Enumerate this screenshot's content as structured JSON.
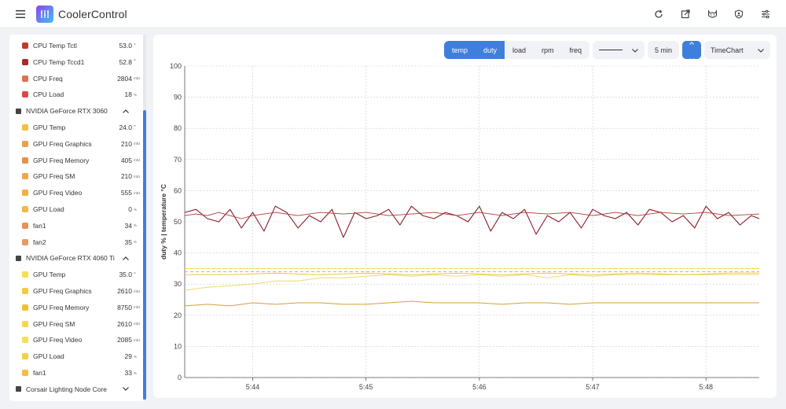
{
  "app": {
    "title": "CoolerControl"
  },
  "icons": {
    "menu": "hamburger-icon",
    "logo": "coolercontrol-logo-icon",
    "top": [
      "refresh-icon",
      "open-external-icon",
      "cat-icon",
      "shield-user-icon",
      "settings-sliders-icon"
    ]
  },
  "sidebar": {
    "rows": [
      {
        "kind": "sensor",
        "name": "CPU Temp Tctl",
        "value": "53.0",
        "unit": "°",
        "color": "#c0392b"
      },
      {
        "kind": "sensor",
        "name": "CPU Temp Tccd1",
        "value": "52.8",
        "unit": "°",
        "color": "#a52a2a"
      },
      {
        "kind": "sensor",
        "name": "CPU Freq",
        "value": "2804",
        "unit": "mhz",
        "color": "#e07050"
      },
      {
        "kind": "sensor",
        "name": "CPU Load",
        "value": "18",
        "unit": "%",
        "color": "#d94848"
      },
      {
        "kind": "group",
        "name": "NVIDIA GeForce RTX 3060"
      },
      {
        "kind": "sensor",
        "name": "GPU Temp",
        "value": "24.0",
        "unit": "°",
        "color": "#f0c040"
      },
      {
        "kind": "sensor",
        "name": "GPU Freq Graphics",
        "value": "210",
        "unit": "mhz",
        "color": "#e8a050"
      },
      {
        "kind": "sensor",
        "name": "GPU Freq Memory",
        "value": "405",
        "unit": "mhz",
        "color": "#e89048"
      },
      {
        "kind": "sensor",
        "name": "GPU Freq SM",
        "value": "210",
        "unit": "mhz",
        "color": "#f0a848"
      },
      {
        "kind": "sensor",
        "name": "GPU Freq Video",
        "value": "555",
        "unit": "mhz",
        "color": "#f0b040"
      },
      {
        "kind": "sensor",
        "name": "GPU Load",
        "value": "0",
        "unit": "%",
        "color": "#f2b848"
      },
      {
        "kind": "sensor",
        "name": "fan1",
        "value": "34",
        "unit": "%",
        "color": "#e8905a"
      },
      {
        "kind": "sensor",
        "name": "fan2",
        "value": "35",
        "unit": "%",
        "color": "#e89860"
      },
      {
        "kind": "group",
        "name": "NVIDIA GeForce RTX 4060 Ti"
      },
      {
        "kind": "sensor",
        "name": "GPU Temp",
        "value": "35.0",
        "unit": "°",
        "color": "#f5e050"
      },
      {
        "kind": "sensor",
        "name": "GPU Freq Graphics",
        "value": "2610",
        "unit": "mhz",
        "color": "#f2cc3c"
      },
      {
        "kind": "sensor",
        "name": "GPU Freq Memory",
        "value": "8750",
        "unit": "mhz",
        "color": "#f0c030"
      },
      {
        "kind": "sensor",
        "name": "GPU Freq SM",
        "value": "2610",
        "unit": "mhz",
        "color": "#f5d848"
      },
      {
        "kind": "sensor",
        "name": "GPU Freq Video",
        "value": "2085",
        "unit": "mhz",
        "color": "#f5e058"
      },
      {
        "kind": "sensor",
        "name": "GPU Load",
        "value": "29",
        "unit": "%",
        "color": "#f5d040"
      },
      {
        "kind": "sensor",
        "name": "fan1",
        "value": "33",
        "unit": "%",
        "color": "#f2c040"
      },
      {
        "kind": "group",
        "name": "Corsair Lighting Node Core",
        "collapsed": true
      }
    ]
  },
  "toolbar": {
    "modes": [
      {
        "label": "temp",
        "active": true
      },
      {
        "label": "duty",
        "active": true
      },
      {
        "label": "load",
        "active": false
      },
      {
        "label": "rpm",
        "active": false
      },
      {
        "label": "freq",
        "active": false
      }
    ],
    "line_style": "solid-line",
    "time_range": "5 min",
    "chart_type": "TimeChart"
  },
  "chart_data": {
    "type": "line",
    "ylabel": "duty %  |  temperature °C",
    "ylim": [
      0,
      100
    ],
    "yticks": [
      0,
      10,
      20,
      30,
      40,
      50,
      60,
      70,
      80,
      90,
      100
    ],
    "xticks": [
      "5:44",
      "5:45",
      "5:46",
      "5:47",
      "5:48"
    ],
    "xlim": [
      5.4,
      10.47
    ],
    "grid": true,
    "series": [
      {
        "color": "#8b1a2b",
        "width": 1.1,
        "points": [
          [
            5.4,
            53
          ],
          [
            5.5,
            54
          ],
          [
            5.6,
            51
          ],
          [
            5.7,
            50
          ],
          [
            5.8,
            54
          ],
          [
            5.9,
            48
          ],
          [
            6.0,
            53
          ],
          [
            6.1,
            47
          ],
          [
            6.2,
            55
          ],
          [
            6.3,
            53
          ],
          [
            6.4,
            48
          ],
          [
            6.5,
            52
          ],
          [
            6.6,
            50
          ],
          [
            6.7,
            54
          ],
          [
            6.8,
            45
          ],
          [
            6.9,
            53
          ],
          [
            7.0,
            51
          ],
          [
            7.1,
            52
          ],
          [
            7.2,
            54
          ],
          [
            7.3,
            49
          ],
          [
            7.4,
            55
          ],
          [
            7.5,
            52
          ],
          [
            7.6,
            51
          ],
          [
            7.7,
            53
          ],
          [
            7.8,
            52
          ],
          [
            7.9,
            50
          ],
          [
            8.0,
            55
          ],
          [
            8.1,
            47
          ],
          [
            8.2,
            53
          ],
          [
            8.3,
            51
          ],
          [
            8.4,
            54
          ],
          [
            8.5,
            46
          ],
          [
            8.6,
            52
          ],
          [
            8.7,
            50
          ],
          [
            8.8,
            53
          ],
          [
            8.9,
            48
          ],
          [
            9.0,
            54
          ],
          [
            9.1,
            52
          ],
          [
            9.2,
            51
          ],
          [
            9.3,
            53
          ],
          [
            9.4,
            49
          ],
          [
            9.5,
            54
          ],
          [
            9.6,
            53
          ],
          [
            9.7,
            50
          ],
          [
            9.8,
            52
          ],
          [
            9.9,
            48
          ],
          [
            10.0,
            55
          ],
          [
            10.1,
            51
          ],
          [
            10.2,
            53
          ],
          [
            10.3,
            49
          ],
          [
            10.4,
            52
          ],
          [
            10.47,
            51
          ]
        ]
      },
      {
        "color": "#b03a3a",
        "width": 0.9,
        "points": [
          [
            5.4,
            52
          ],
          [
            5.5,
            52.5
          ],
          [
            5.6,
            52
          ],
          [
            5.7,
            53
          ],
          [
            5.8,
            52
          ],
          [
            5.9,
            51
          ],
          [
            6.0,
            52
          ],
          [
            6.2,
            53
          ],
          [
            6.4,
            52
          ],
          [
            6.6,
            53
          ],
          [
            6.8,
            52.5
          ],
          [
            7.0,
            53
          ],
          [
            7.2,
            52
          ],
          [
            7.4,
            52.5
          ],
          [
            7.6,
            53
          ],
          [
            7.8,
            52
          ],
          [
            8.0,
            53
          ],
          [
            8.2,
            52
          ],
          [
            8.4,
            53
          ],
          [
            8.6,
            52.5
          ],
          [
            8.8,
            53
          ],
          [
            9.0,
            52
          ],
          [
            9.2,
            53
          ],
          [
            9.4,
            52
          ],
          [
            9.6,
            53
          ],
          [
            9.8,
            52.5
          ],
          [
            10.0,
            53
          ],
          [
            10.2,
            52
          ],
          [
            10.47,
            52.5
          ]
        ]
      },
      {
        "color": "#d4a03a",
        "width": 1.0,
        "points": [
          [
            5.4,
            23
          ],
          [
            5.6,
            23.5
          ],
          [
            5.8,
            23
          ],
          [
            6.0,
            24
          ],
          [
            6.2,
            23.5
          ],
          [
            6.4,
            24
          ],
          [
            6.6,
            24
          ],
          [
            6.8,
            23.5
          ],
          [
            7.0,
            23.5
          ],
          [
            7.2,
            24
          ],
          [
            7.4,
            24.5
          ],
          [
            7.6,
            24
          ],
          [
            7.8,
            24
          ],
          [
            8.0,
            24
          ],
          [
            8.2,
            23.5
          ],
          [
            8.4,
            24
          ],
          [
            8.6,
            24
          ],
          [
            8.8,
            23.5
          ],
          [
            9.0,
            24
          ],
          [
            9.2,
            24
          ],
          [
            9.4,
            24
          ],
          [
            9.6,
            24
          ],
          [
            9.8,
            24
          ],
          [
            10.0,
            24
          ],
          [
            10.2,
            24
          ],
          [
            10.47,
            24
          ]
        ]
      },
      {
        "color": "#f0d870",
        "width": 1.0,
        "points": [
          [
            5.4,
            28
          ],
          [
            5.6,
            29
          ],
          [
            5.8,
            29.5
          ],
          [
            6.0,
            30
          ],
          [
            6.2,
            31
          ],
          [
            6.4,
            31
          ],
          [
            6.6,
            32
          ],
          [
            6.8,
            32
          ],
          [
            7.0,
            32.5
          ],
          [
            7.2,
            33
          ],
          [
            7.4,
            32.5
          ],
          [
            7.6,
            33
          ],
          [
            7.8,
            32.5
          ],
          [
            8.0,
            33
          ],
          [
            8.2,
            32.5
          ],
          [
            8.4,
            33
          ],
          [
            8.6,
            32
          ],
          [
            8.8,
            33
          ],
          [
            9.0,
            32.5
          ],
          [
            9.2,
            33
          ],
          [
            9.4,
            33
          ],
          [
            9.6,
            33
          ],
          [
            9.8,
            33
          ],
          [
            10.0,
            33
          ],
          [
            10.2,
            33
          ],
          [
            10.47,
            33
          ]
        ]
      },
      {
        "color": "#e8c848",
        "width": 1.0,
        "points": [
          [
            5.4,
            33
          ],
          [
            5.8,
            33
          ],
          [
            6.2,
            33.5
          ],
          [
            6.6,
            33
          ],
          [
            7.0,
            33.5
          ],
          [
            7.4,
            33
          ],
          [
            7.8,
            33.5
          ],
          [
            8.2,
            33
          ],
          [
            8.6,
            33.5
          ],
          [
            9.0,
            33
          ],
          [
            9.4,
            33.5
          ],
          [
            9.8,
            33
          ],
          [
            10.2,
            33.5
          ],
          [
            10.47,
            33.5
          ]
        ]
      },
      {
        "color": "#e8a050",
        "width": 0.9,
        "dash": "4 3",
        "points": [
          [
            5.4,
            34
          ],
          [
            6.4,
            34
          ],
          [
            7.4,
            34
          ],
          [
            8.4,
            34
          ],
          [
            9.4,
            34
          ],
          [
            10.47,
            34
          ]
        ]
      },
      {
        "color": "#d85a5a",
        "width": 0.9,
        "dash": "4 3",
        "points": [
          [
            5.4,
            35
          ],
          [
            6.4,
            35
          ],
          [
            7.4,
            35
          ],
          [
            8.4,
            35
          ],
          [
            9.4,
            35
          ],
          [
            10.47,
            35
          ]
        ]
      },
      {
        "color": "#f5e058",
        "width": 1.0,
        "points": [
          [
            5.4,
            35
          ],
          [
            6.4,
            35
          ],
          [
            7.4,
            35
          ],
          [
            8.4,
            35
          ],
          [
            9.4,
            35
          ],
          [
            10.47,
            35
          ]
        ]
      }
    ]
  }
}
